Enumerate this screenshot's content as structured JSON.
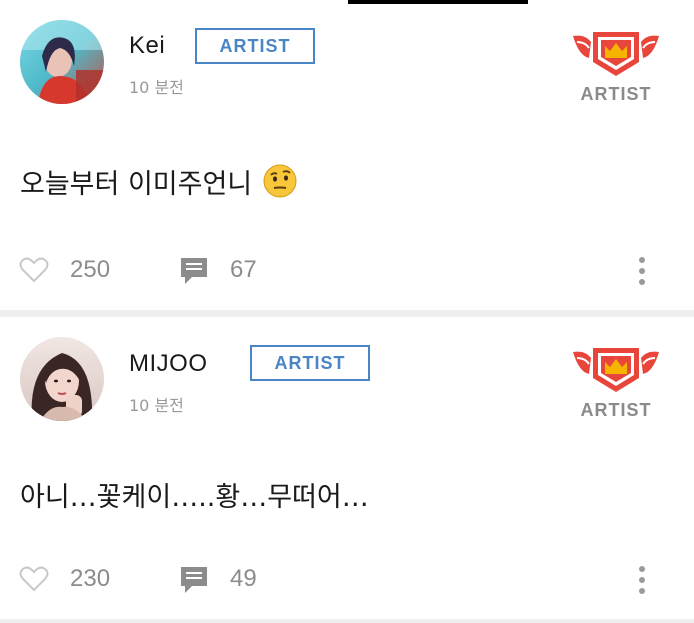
{
  "posts": [
    {
      "author": "Kei",
      "badge": "ARTIST",
      "time": "10 분전",
      "rank_label": "ARTIST",
      "text": "오늘부터 이미주언니",
      "emoji": "face-with-raised-eyebrow",
      "likes": "250",
      "comments": "67"
    },
    {
      "author": "MIJOO",
      "badge": "ARTIST",
      "time": "10 분전",
      "rank_label": "ARTIST",
      "text": "아니…꽃케이…..황…무떠어…",
      "likes": "230",
      "comments": "49"
    }
  ],
  "colors": {
    "badge_blue": "#4a86c5",
    "crown_red": "#e8463b",
    "crown_gold": "#f5b400",
    "muted_gray": "#8c8c8c"
  },
  "icons": [
    "heart-icon",
    "comment-icon",
    "more-vertical-icon",
    "crown-icon"
  ]
}
